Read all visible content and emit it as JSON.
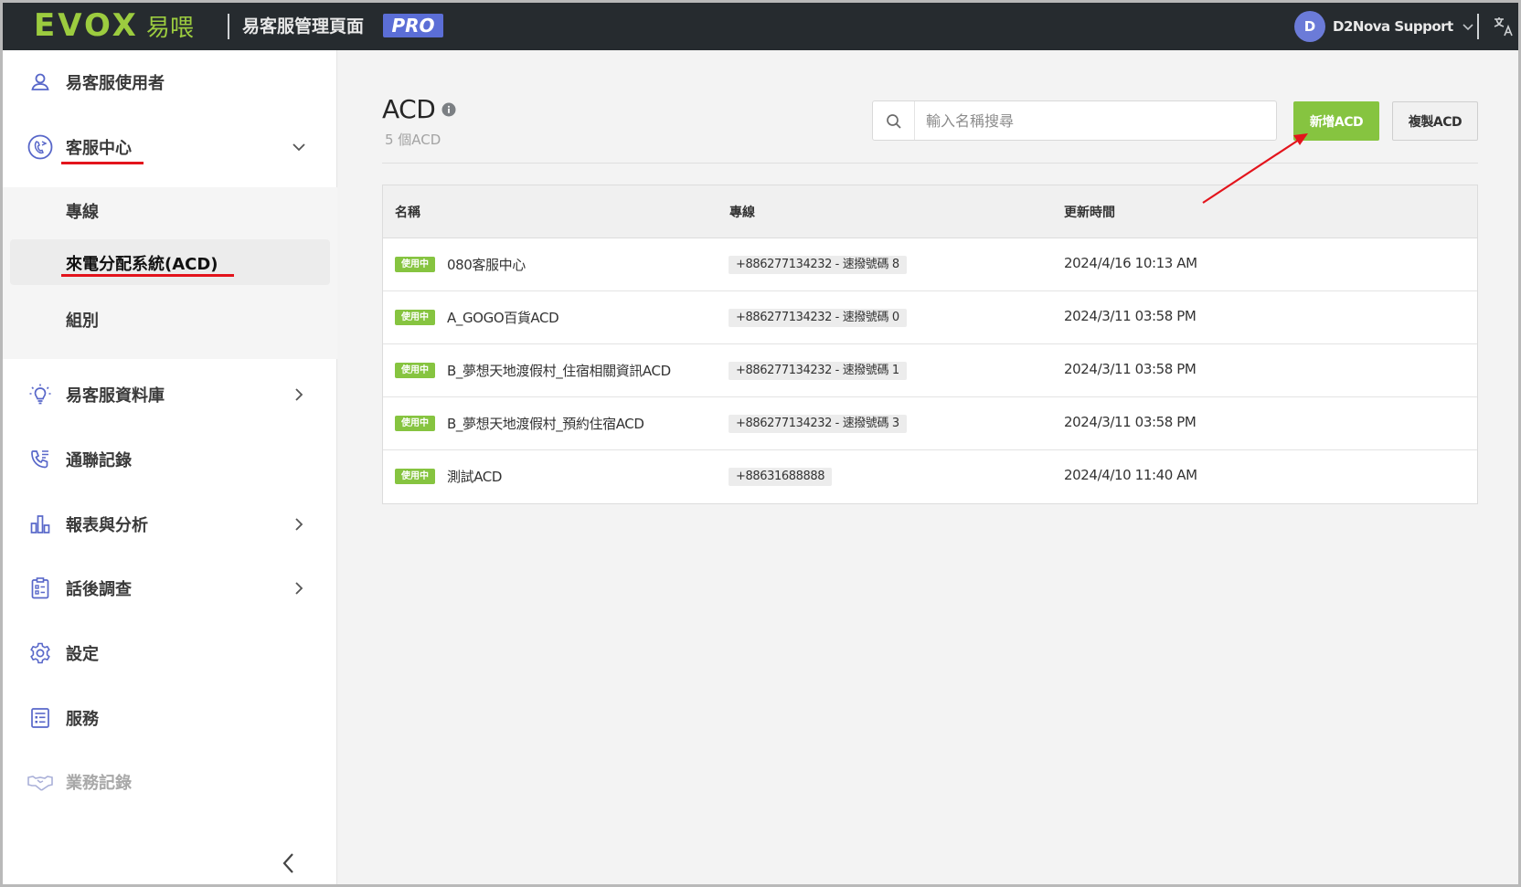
{
  "topbar": {
    "logo_latin": "EVOX",
    "logo_cjk": "易喂",
    "app_title": "易客服管理頁面",
    "pro_badge": "PRO",
    "user_initial": "D",
    "user_name": "D2Nova Support"
  },
  "sidebar": {
    "items": [
      {
        "label": "易客服使用者",
        "icon": "user-icon"
      },
      {
        "label": "客服中心",
        "icon": "call-center-icon"
      },
      {
        "label": "易客服資料庫",
        "icon": "lightbulb-icon"
      },
      {
        "label": "通聯記錄",
        "icon": "phone-log-icon"
      },
      {
        "label": "報表與分析",
        "icon": "bar-chart-icon"
      },
      {
        "label": "話後調查",
        "icon": "survey-clipboard-icon"
      },
      {
        "label": "設定",
        "icon": "gear-icon"
      },
      {
        "label": "服務",
        "icon": "service-list-icon"
      },
      {
        "label": "業務記錄",
        "icon": "handshake-icon"
      }
    ],
    "submenu": [
      {
        "label": "專線"
      },
      {
        "label": "來電分配系統(ACD)"
      },
      {
        "label": "組別"
      }
    ]
  },
  "main": {
    "title": "ACD",
    "subtitle": "5 個ACD",
    "search_placeholder": "輸入名稱搜尋",
    "add_button": "新增ACD",
    "copy_button": "複製ACD",
    "columns": [
      "名稱",
      "專線",
      "更新時間"
    ],
    "rows": [
      {
        "status": "使用中",
        "name": "080客服中心",
        "line": "+886277134232 - 速撥號碼 8",
        "updated": "2024/4/16 10:13 AM"
      },
      {
        "status": "使用中",
        "name": "A_GOGO百貨ACD",
        "line": "+886277134232 - 速撥號碼 0",
        "updated": "2024/3/11 03:58 PM"
      },
      {
        "status": "使用中",
        "name": "B_夢想天地渡假村_住宿相關資訊ACD",
        "line": "+886277134232 - 速撥號碼 1",
        "updated": "2024/3/11 03:58 PM"
      },
      {
        "status": "使用中",
        "name": "B_夢想天地渡假村_預約住宿ACD",
        "line": "+886277134232 - 速撥號碼 3",
        "updated": "2024/3/11 03:58 PM"
      },
      {
        "status": "使用中",
        "name": "測試ACD",
        "line": "+88631688888",
        "updated": "2024/4/10 11:40 AM"
      }
    ]
  },
  "colors": {
    "topbar_bg": "#262b2f",
    "brand_green": "#9ccc3f",
    "accent_green": "#86c440",
    "pro_purple": "#5b6ed6",
    "icon_blue": "#5867c9",
    "annotation_red": "#e3141c"
  }
}
